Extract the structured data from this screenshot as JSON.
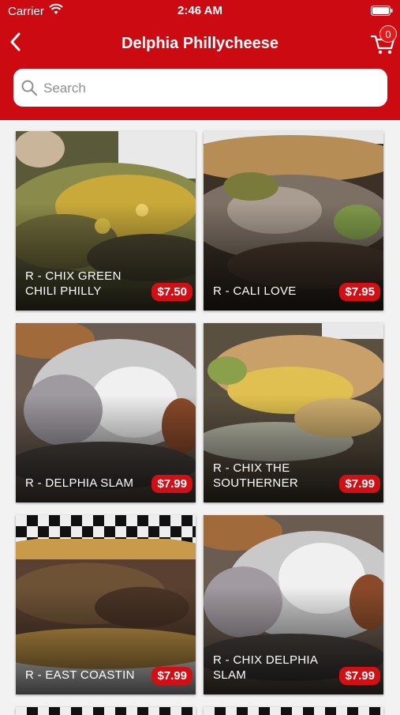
{
  "status_bar": {
    "carrier": "Carrier",
    "time": "2:46 AM"
  },
  "navbar": {
    "title": "Delphia Phillycheese",
    "cart_count": "0"
  },
  "search": {
    "placeholder": "Search"
  },
  "items": [
    {
      "name": "R - CHIX GREEN CHILI PHILLY",
      "price": "$7.50"
    },
    {
      "name": "R - CALI LOVE",
      "price": "$7.95"
    },
    {
      "name": "R - DELPHIA SLAM",
      "price": "$7.99"
    },
    {
      "name": "R - CHIX THE SOUTHERNER",
      "price": "$7.99"
    },
    {
      "name": "R - EAST COASTIN",
      "price": "$7.99"
    },
    {
      "name": "R - CHIX DELPHIA SLAM",
      "price": "$7.99"
    }
  ],
  "colors": {
    "brand": "#cc0a12",
    "price_badge": "#d10f15"
  }
}
